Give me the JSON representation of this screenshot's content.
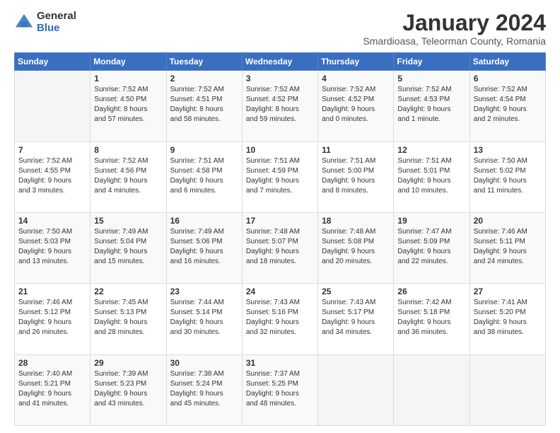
{
  "logo": {
    "general": "General",
    "blue": "Blue"
  },
  "header": {
    "title": "January 2024",
    "subtitle": "Smardioasa, Teleorman County, Romania"
  },
  "weekdays": [
    "Sunday",
    "Monday",
    "Tuesday",
    "Wednesday",
    "Thursday",
    "Friday",
    "Saturday"
  ],
  "weeks": [
    [
      {
        "day": "",
        "info": ""
      },
      {
        "day": "1",
        "info": "Sunrise: 7:52 AM\nSunset: 4:50 PM\nDaylight: 8 hours\nand 57 minutes."
      },
      {
        "day": "2",
        "info": "Sunrise: 7:52 AM\nSunset: 4:51 PM\nDaylight: 8 hours\nand 58 minutes."
      },
      {
        "day": "3",
        "info": "Sunrise: 7:52 AM\nSunset: 4:52 PM\nDaylight: 8 hours\nand 59 minutes."
      },
      {
        "day": "4",
        "info": "Sunrise: 7:52 AM\nSunset: 4:52 PM\nDaylight: 9 hours\nand 0 minutes."
      },
      {
        "day": "5",
        "info": "Sunrise: 7:52 AM\nSunset: 4:53 PM\nDaylight: 9 hours\nand 1 minute."
      },
      {
        "day": "6",
        "info": "Sunrise: 7:52 AM\nSunset: 4:54 PM\nDaylight: 9 hours\nand 2 minutes."
      }
    ],
    [
      {
        "day": "7",
        "info": "Sunrise: 7:52 AM\nSunset: 4:55 PM\nDaylight: 9 hours\nand 3 minutes."
      },
      {
        "day": "8",
        "info": "Sunrise: 7:52 AM\nSunset: 4:56 PM\nDaylight: 9 hours\nand 4 minutes."
      },
      {
        "day": "9",
        "info": "Sunrise: 7:51 AM\nSunset: 4:58 PM\nDaylight: 9 hours\nand 6 minutes."
      },
      {
        "day": "10",
        "info": "Sunrise: 7:51 AM\nSunset: 4:59 PM\nDaylight: 9 hours\nand 7 minutes."
      },
      {
        "day": "11",
        "info": "Sunrise: 7:51 AM\nSunset: 5:00 PM\nDaylight: 9 hours\nand 8 minutes."
      },
      {
        "day": "12",
        "info": "Sunrise: 7:51 AM\nSunset: 5:01 PM\nDaylight: 9 hours\nand 10 minutes."
      },
      {
        "day": "13",
        "info": "Sunrise: 7:50 AM\nSunset: 5:02 PM\nDaylight: 9 hours\nand 11 minutes."
      }
    ],
    [
      {
        "day": "14",
        "info": "Sunrise: 7:50 AM\nSunset: 5:03 PM\nDaylight: 9 hours\nand 13 minutes."
      },
      {
        "day": "15",
        "info": "Sunrise: 7:49 AM\nSunset: 5:04 PM\nDaylight: 9 hours\nand 15 minutes."
      },
      {
        "day": "16",
        "info": "Sunrise: 7:49 AM\nSunset: 5:06 PM\nDaylight: 9 hours\nand 16 minutes."
      },
      {
        "day": "17",
        "info": "Sunrise: 7:48 AM\nSunset: 5:07 PM\nDaylight: 9 hours\nand 18 minutes."
      },
      {
        "day": "18",
        "info": "Sunrise: 7:48 AM\nSunset: 5:08 PM\nDaylight: 9 hours\nand 20 minutes."
      },
      {
        "day": "19",
        "info": "Sunrise: 7:47 AM\nSunset: 5:09 PM\nDaylight: 9 hours\nand 22 minutes."
      },
      {
        "day": "20",
        "info": "Sunrise: 7:46 AM\nSunset: 5:11 PM\nDaylight: 9 hours\nand 24 minutes."
      }
    ],
    [
      {
        "day": "21",
        "info": "Sunrise: 7:46 AM\nSunset: 5:12 PM\nDaylight: 9 hours\nand 26 minutes."
      },
      {
        "day": "22",
        "info": "Sunrise: 7:45 AM\nSunset: 5:13 PM\nDaylight: 9 hours\nand 28 minutes."
      },
      {
        "day": "23",
        "info": "Sunrise: 7:44 AM\nSunset: 5:14 PM\nDaylight: 9 hours\nand 30 minutes."
      },
      {
        "day": "24",
        "info": "Sunrise: 7:43 AM\nSunset: 5:16 PM\nDaylight: 9 hours\nand 32 minutes."
      },
      {
        "day": "25",
        "info": "Sunrise: 7:43 AM\nSunset: 5:17 PM\nDaylight: 9 hours\nand 34 minutes."
      },
      {
        "day": "26",
        "info": "Sunrise: 7:42 AM\nSunset: 5:18 PM\nDaylight: 9 hours\nand 36 minutes."
      },
      {
        "day": "27",
        "info": "Sunrise: 7:41 AM\nSunset: 5:20 PM\nDaylight: 9 hours\nand 38 minutes."
      }
    ],
    [
      {
        "day": "28",
        "info": "Sunrise: 7:40 AM\nSunset: 5:21 PM\nDaylight: 9 hours\nand 41 minutes."
      },
      {
        "day": "29",
        "info": "Sunrise: 7:39 AM\nSunset: 5:23 PM\nDaylight: 9 hours\nand 43 minutes."
      },
      {
        "day": "30",
        "info": "Sunrise: 7:38 AM\nSunset: 5:24 PM\nDaylight: 9 hours\nand 45 minutes."
      },
      {
        "day": "31",
        "info": "Sunrise: 7:37 AM\nSunset: 5:25 PM\nDaylight: 9 hours\nand 48 minutes."
      },
      {
        "day": "",
        "info": ""
      },
      {
        "day": "",
        "info": ""
      },
      {
        "day": "",
        "info": ""
      }
    ]
  ]
}
